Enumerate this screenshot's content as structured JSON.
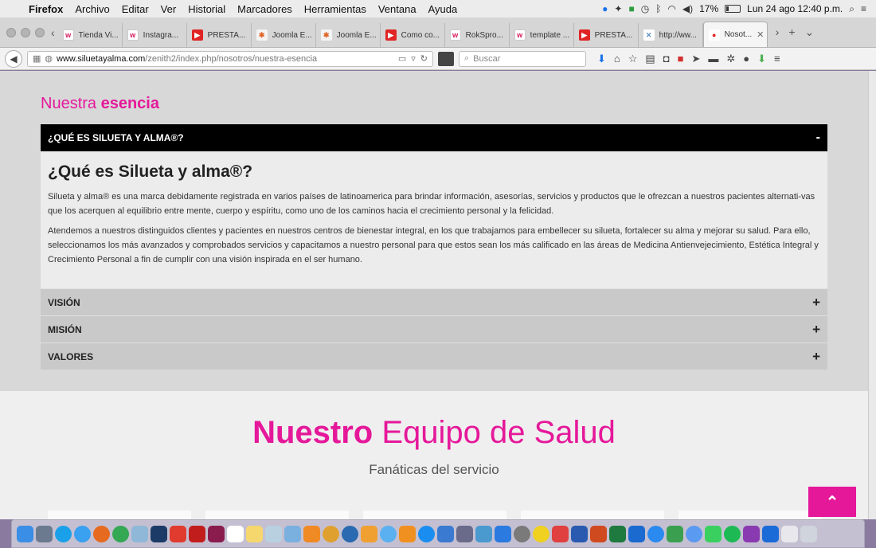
{
  "menubar": {
    "app": "Firefox",
    "items": [
      "Archivo",
      "Editar",
      "Ver",
      "Historial",
      "Marcadores",
      "Herramientas",
      "Ventana",
      "Ayuda"
    ],
    "battery": "17%",
    "clock": "Lun 24 ago  12:40 p.m."
  },
  "tabs": [
    {
      "label": "Tienda Vi...",
      "icon": "w"
    },
    {
      "label": "Instagra...",
      "icon": "w"
    },
    {
      "label": "PRESTA...",
      "icon": "youtube"
    },
    {
      "label": "Joomla E...",
      "icon": "joomla"
    },
    {
      "label": "Joomla E...",
      "icon": "joomla"
    },
    {
      "label": "Como co...",
      "icon": "youtube"
    },
    {
      "label": "RokSpro...",
      "icon": "w"
    },
    {
      "label": "template ...",
      "icon": "w"
    },
    {
      "label": "PRESTA...",
      "icon": "youtube"
    },
    {
      "label": "http://ww...",
      "icon": "x"
    },
    {
      "label": "Nosot...",
      "icon": "drop",
      "active": true
    }
  ],
  "navbar": {
    "url_host": "www.siluetayalma.com",
    "url_path": "/zenith2/index.php/nosotros/nuestra-esencia",
    "search_placeholder": "Buscar"
  },
  "page": {
    "section_title_light": "Nuestra ",
    "section_title_bold": "esencia",
    "accordion": {
      "open_header": "¿QUÉ ES SILUETA Y ALMA®?",
      "open_sign": "-",
      "heading": "¿Qué es Silueta y alma®?",
      "p1": "Silueta y alma® es una marca debidamente registrada en varios países de latinoamerica para brindar información, asesorías, servicios y productos que le ofrezcan a nuestros pacientes alternati-vas que los acerquen al equilibrio entre mente, cuerpo y espíritu, como uno de los caminos hacia el crecimiento personal y la felicidad.",
      "p2": "Atendemos a nuestros distinguidos clientes y pacientes en nuestros centros de bienestar integral, en los que trabajamos para embellecer su silueta, fortalecer su alma y mejorar su salud. Para ello, seleccionamos los más avanzados y comprobados servicios y capacitamos a nuestro personal para que estos sean los más calificado en las áreas de Medicina Antienvejecimiento, Estética Integral y Crecimiento Personal a fin de cumplir con una visión inspirada en el ser humano.",
      "closed": [
        {
          "label": "VISIÓN",
          "sign": "+"
        },
        {
          "label": "MISIÓN",
          "sign": "+"
        },
        {
          "label": "VALORES",
          "sign": "+"
        }
      ]
    },
    "team_title_bold": "Nuestro",
    "team_title_light": " Equipo de Salud",
    "team_subtitle": "Fanáticas del servicio",
    "to_top": "⌃"
  },
  "colors": {
    "accent": "#e5189a",
    "header_bg": "#000000"
  }
}
